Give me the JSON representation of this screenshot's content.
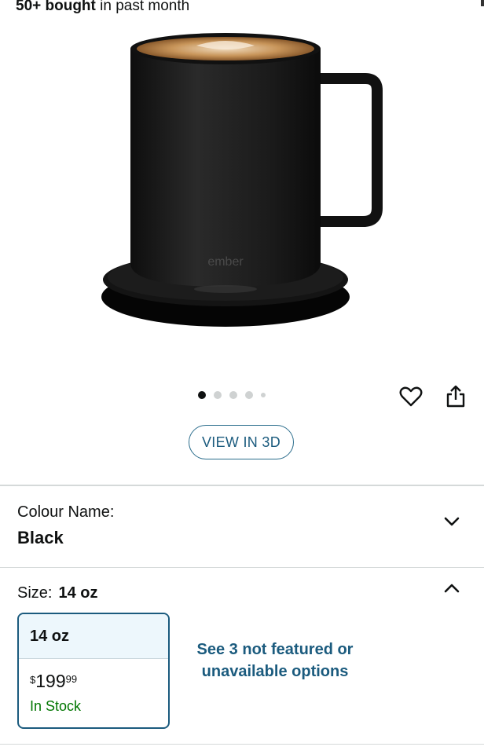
{
  "header": {
    "bought_bold": "50+ bought",
    "bought_rest": " in past month"
  },
  "product_image": {
    "brand_mark": "ember",
    "mug_color": "#1c1c1c",
    "coffee_color": "#c8955a"
  },
  "carousel": {
    "count": 5,
    "active_index": 0
  },
  "actions": {
    "wishlist_icon": "heart-icon",
    "share_icon": "share-icon",
    "view_3d_label": "VIEW IN 3D"
  },
  "colour": {
    "label": "Colour Name:",
    "value": "Black",
    "toggle_icon": "chevron-down-icon"
  },
  "size": {
    "label": "Size:",
    "selected": "14 oz",
    "toggle_icon": "chevron-up-icon",
    "options": [
      {
        "name": "14 oz",
        "price_symbol": "$",
        "price_whole": "199",
        "price_fraction": "99",
        "availability": "In Stock"
      }
    ],
    "more_options": "See 3 not featured or unavailable options"
  },
  "colors": {
    "link": "#1b5b7e",
    "in_stock": "#007600",
    "selected_bg": "#edf7fc"
  }
}
